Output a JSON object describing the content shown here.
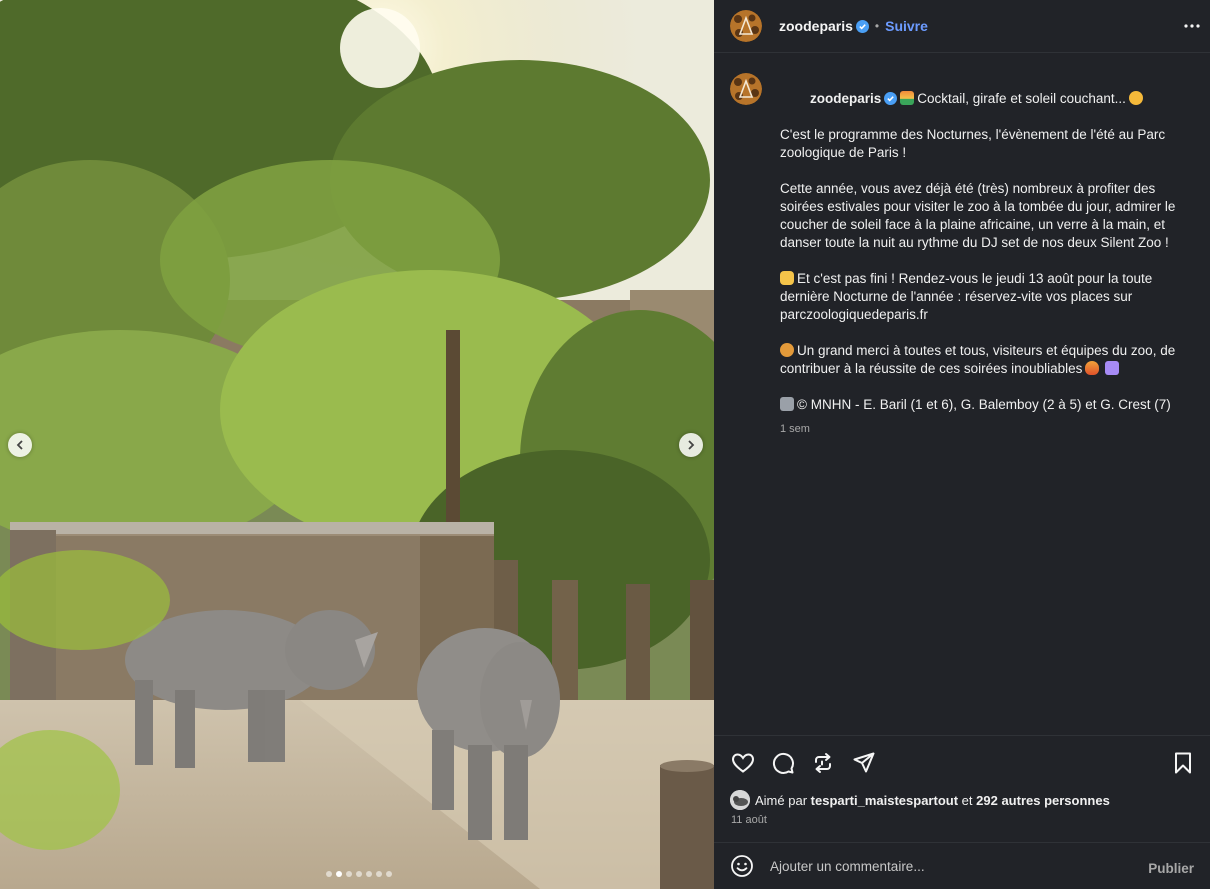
{
  "post": {
    "username": "zoodeparis",
    "follow_label": "Suivre",
    "separator": "•",
    "verified_icon": "verified-badge-icon",
    "more_icon": "more-options-icon"
  },
  "caption": {
    "username": "zoodeparis",
    "line1": "Cocktail, girafe et soleil couchant...",
    "line2": "C'est le programme des Nocturnes, l'évènement de l'été au Parc zoologique de Paris !",
    "para2": "Cette année, vous avez déjà été (très) nombreux à profiter des soirées estivales pour visiter le zoo à la tombée du jour, admirer le coucher de soleil face à la plaine africaine, un verre à la main, et danser toute la nuit au rythme du DJ set de nos deux Silent Zoo !",
    "para3": "Et c'est pas fini ! Rendez-vous le jeudi 13 août pour la toute dernière Nocturne de l'année : réservez-vite vos places sur parczoologiquedeparis.fr",
    "para4": "Un grand merci à toutes et tous, visiteurs et équipes du zoo, de contribuer à la réussite de ces soirées inoubliables",
    "para5": "© MNHN - E. Baril (1 et 6), G. Balemboy (2 à 5) et G. Crest (7)",
    "time": "1 sem"
  },
  "actions": {
    "like_icon": "heart-icon",
    "comment_icon": "comment-icon",
    "repost_icon": "repost-icon",
    "share_icon": "share-icon",
    "save_icon": "bookmark-icon"
  },
  "likes": {
    "prefix": "Aimé par",
    "user": "tesparti_maistespartout",
    "conj": "et",
    "others": "292 autres personnes"
  },
  "date": "11 août",
  "comment": {
    "placeholder": "Ajouter un commentaire...",
    "post_label": "Publier"
  },
  "carousel": {
    "total": 7,
    "active": 2
  },
  "colors": {
    "panel_bg": "#212328",
    "link_blue": "#6c9bff",
    "muted": "#a8a8a8"
  }
}
